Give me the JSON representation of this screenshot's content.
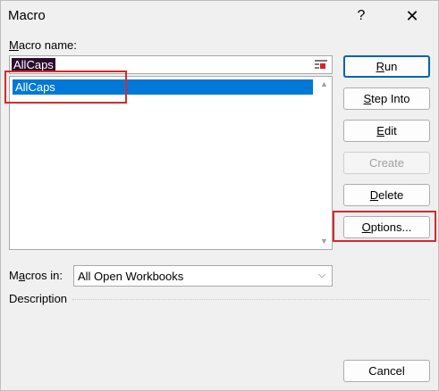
{
  "window": {
    "title": "Macro",
    "help_glyph": "?",
    "close_glyph": "✕"
  },
  "macro_name": {
    "label_hotkey": "M",
    "label_rest": "acro name:",
    "value": "AllCaps"
  },
  "macro_list": {
    "items": [
      "AllCaps"
    ],
    "selected_index": 0,
    "scroll_up_glyph": "▲",
    "scroll_down_glyph": "▼"
  },
  "buttons": {
    "run": {
      "hotkey": "R",
      "rest": "un"
    },
    "step_into": {
      "hotkey": "S",
      "rest": "tep Into"
    },
    "edit": {
      "hotkey": "E",
      "rest": "dit"
    },
    "create": {
      "label": "Create",
      "disabled": true
    },
    "delete": {
      "hotkey": "D",
      "rest": "elete"
    },
    "options": {
      "hotkey": "O",
      "rest": "ptions..."
    },
    "cancel": {
      "label": "Cancel"
    }
  },
  "macros_in": {
    "label_pre": "M",
    "label_hotkey": "a",
    "label_rest": "cros in:",
    "value": "All Open Workbooks",
    "chevron_glyph": "⌵"
  },
  "description": {
    "label": "Description"
  },
  "colors": {
    "selection": "#0078d7",
    "annotation_red": "#d42a2a",
    "primary_border": "#0063b1"
  }
}
